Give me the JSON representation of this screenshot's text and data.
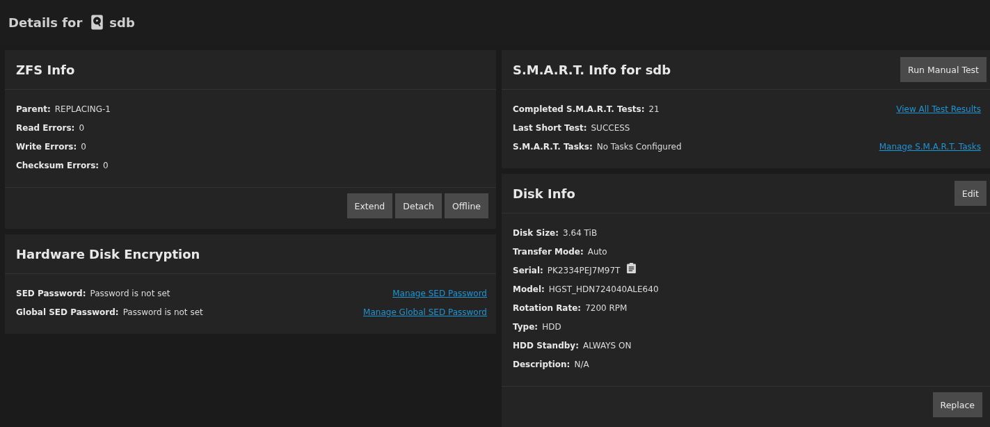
{
  "page_title": {
    "prefix": "Details for",
    "disk": "sdb"
  },
  "columns": [
    {
      "cards": [
        {
          "title": "ZFS Info",
          "rows": [
            {
              "label": "Parent:",
              "value": "REPLACING-1"
            },
            {
              "label": "Read Errors:",
              "value": "0"
            },
            {
              "label": "Write Errors:",
              "value": "0"
            },
            {
              "label": "Checksum Errors:",
              "value": "0"
            }
          ],
          "footer_buttons": [
            "Extend",
            "Detach",
            "Offline"
          ]
        },
        {
          "title": "Hardware Disk Encryption",
          "rows": [
            {
              "label": "SED Password:",
              "value": "Password is not set",
              "link": "Manage SED Password"
            },
            {
              "label": "Global SED Password:",
              "value": "Password is not set",
              "link": "Manage Global SED Password"
            }
          ]
        }
      ]
    },
    {
      "cards": [
        {
          "title": "S.M.A.R.T. Info for sdb",
          "header_button": "Run Manual Test",
          "rows": [
            {
              "label": "Completed S.M.A.R.T. Tests:",
              "value": "21",
              "link": "View All Test Results"
            },
            {
              "label": "Last Short Test:",
              "value": "SUCCESS"
            },
            {
              "label": "S.M.A.R.T. Tasks:",
              "value": "No Tasks Configured",
              "link": "Manage S.M.A.R.T. Tasks"
            }
          ]
        },
        {
          "title": "Disk Info",
          "header_button": "Edit",
          "rows": [
            {
              "label": "Disk Size:",
              "value": "3.64 TiB"
            },
            {
              "label": "Transfer Mode:",
              "value": "Auto"
            },
            {
              "label": "Serial:",
              "value": "PK2334PEJ7M97T",
              "copy": true
            },
            {
              "label": "Model:",
              "value": "HGST_HDN724040ALE640"
            },
            {
              "label": "Rotation Rate:",
              "value": "7200 RPM"
            },
            {
              "label": "Type:",
              "value": "HDD"
            },
            {
              "label": "HDD Standby:",
              "value": "ALWAYS ON"
            },
            {
              "label": "Description:",
              "value": "N/A"
            }
          ],
          "footer_buttons": [
            "Replace"
          ]
        }
      ]
    }
  ]
}
